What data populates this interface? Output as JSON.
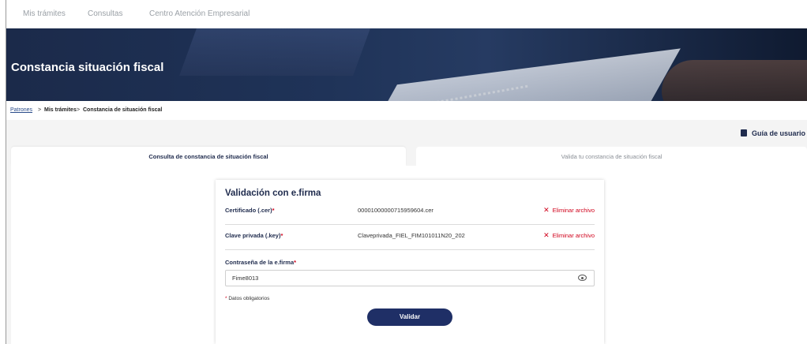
{
  "topnav": {
    "items": [
      "Mis trámites",
      "Consultas",
      "Centro Atención Empresarial"
    ]
  },
  "hero": {
    "title": "Constancia situación fiscal"
  },
  "breadcrumb": {
    "items": [
      "Patrones",
      "Mis trámites",
      "Constancia de situación fiscal"
    ],
    "separator": ">"
  },
  "guide": {
    "label": "Guía de usuario"
  },
  "tabs": [
    {
      "label": "Consulta de constancia de situación fiscal",
      "active": true
    },
    {
      "label": "Valida tu constancia de situación fiscal",
      "active": false
    }
  ],
  "card": {
    "title": "Validación con e.firma",
    "rows": [
      {
        "label": "Certificado (.cer)",
        "required": "*",
        "value": "00001000000715959604.cer",
        "action": "Eliminar archivo"
      },
      {
        "label": "Clave privada (.key)",
        "required": "*",
        "value": "Claveprivada_FIEL_FIM101011N20_202",
        "action": "Eliminar archivo"
      }
    ],
    "password": {
      "label": "Contraseña de la e.firma",
      "required": "*",
      "value": "Fime8013"
    },
    "required_note": {
      "mark": "*",
      "text": "Datos obligatorios"
    },
    "submit_label": "Validar"
  },
  "colors": {
    "primary": "#1f2f66",
    "danger": "#d0021b",
    "heading": "#1f2b4d"
  }
}
